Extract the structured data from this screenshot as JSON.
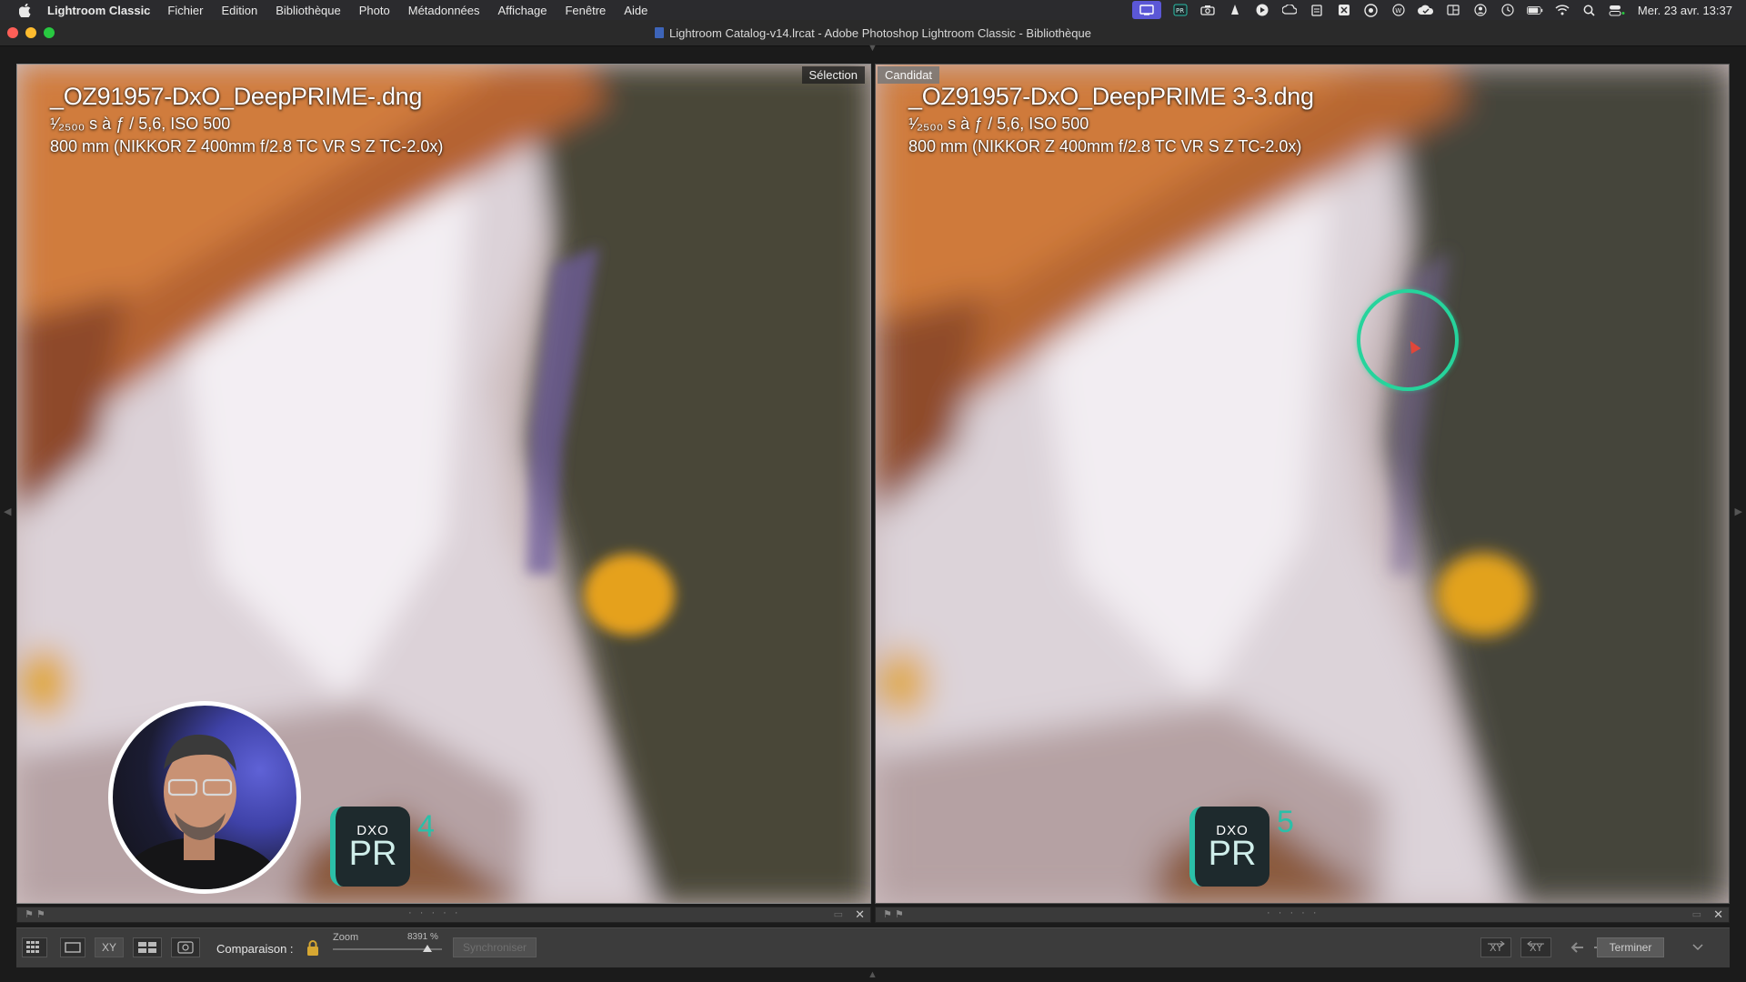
{
  "menubar": {
    "app_name": "Lightroom Classic",
    "items": [
      "Fichier",
      "Edition",
      "Bibliothèque",
      "Photo",
      "Métadonnées",
      "Affichage",
      "Fenêtre",
      "Aide"
    ],
    "clock": "Mer. 23 avr.  13:37"
  },
  "window": {
    "title": "Lightroom Catalog-v14.lrcat - Adobe Photoshop Lightroom Classic - Bibliothèque"
  },
  "left_pane": {
    "tag": "Sélection",
    "filename": "_OZ91957-DxO_DeepPRIME-.dng",
    "exposure": "¹⁄₂₅₀₀ s à ƒ / 5,6, ISO 500",
    "lens": "800 mm (NIKKOR Z 400mm f/2.8 TC VR S Z TC-2.0x)",
    "badge_top": "DXO",
    "badge_pr": "PR",
    "badge_version": "4"
  },
  "right_pane": {
    "tag": "Candidat",
    "filename": "_OZ91957-DxO_DeepPRIME 3-3.dng",
    "exposure": "¹⁄₂₅₀₀ s à ƒ / 5,6, ISO 500",
    "lens": "800 mm (NIKKOR Z 400mm f/2.8 TC VR S Z TC-2.0x)",
    "badge_top": "DXO",
    "badge_pr": "PR",
    "badge_version": "5"
  },
  "strip": {
    "flags": "⚑⚑",
    "dots": "· · · · ·",
    "close": "✕"
  },
  "toolbar": {
    "comparison_label": "Comparaison :",
    "zoom_label": "Zoom",
    "zoom_value": "8391 %",
    "sync_label": "Synchroniser",
    "done_label": "Terminer",
    "xy_label": "XY"
  },
  "colors": {
    "accent_ring": "#26d49c",
    "dxo_teal": "#2bbfa8",
    "lock": "#d6a732"
  },
  "icons": {
    "grid_view": "grid-view-icon",
    "loupe_view": "loupe-view-icon",
    "compare_view": "compare-view-icon",
    "survey_view": "survey-view-icon",
    "people_view": "people-view-icon"
  }
}
